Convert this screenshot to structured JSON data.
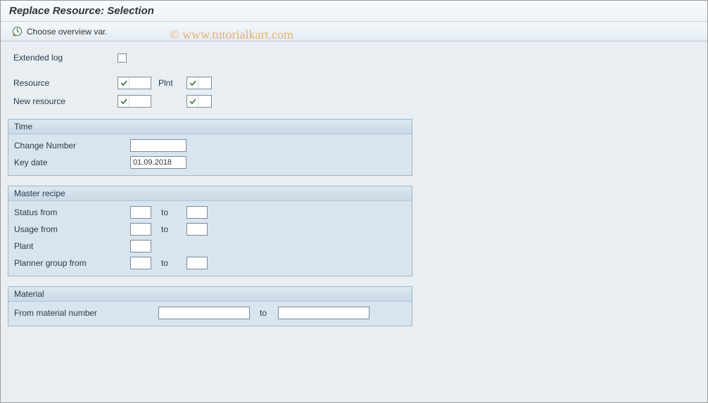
{
  "header": {
    "title": "Replace Resource: Selection"
  },
  "toolbar": {
    "choose_overview": "Choose overview var."
  },
  "watermark": "© www.tutorialkart.com",
  "top": {
    "extended_log_label": "Extended log",
    "extended_log_checked": false,
    "resource_label": "Resource",
    "new_resource_label": "New resource",
    "plnt_label": "Plnt",
    "resource_value": "",
    "new_resource_value": "",
    "plnt_value": "",
    "plnt2_value": ""
  },
  "time_group": {
    "title": "Time",
    "change_number_label": "Change Number",
    "change_number_value": "",
    "key_date_label": "Key date",
    "key_date_value": "01.09.2018"
  },
  "recipe_group": {
    "title": "Master recipe",
    "status_from_label": "Status from",
    "usage_from_label": "Usage from",
    "plant_label": "Plant",
    "planner_group_label": "Planner group from",
    "to_label": "to",
    "status_from": "",
    "status_to": "",
    "usage_from": "",
    "usage_to": "",
    "plant": "",
    "planner_from": "",
    "planner_to": ""
  },
  "material_group": {
    "title": "Material",
    "from_material_label": "From material number",
    "to_label": "to",
    "from_value": "",
    "to_value": ""
  }
}
